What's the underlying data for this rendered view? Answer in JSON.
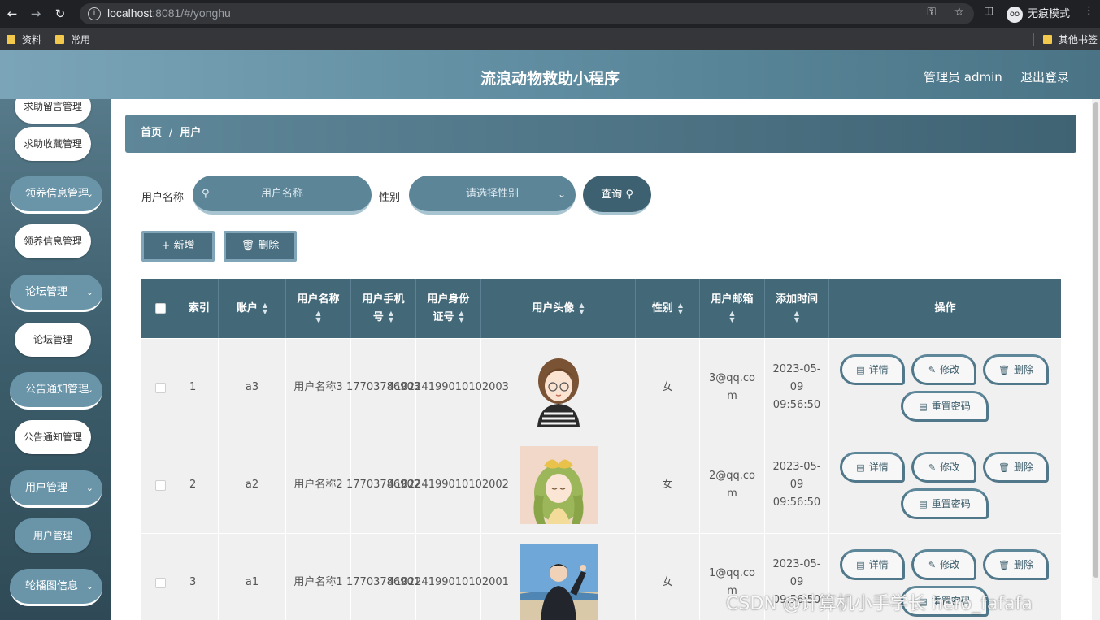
{
  "browser": {
    "url_host": "localhost",
    "url_rest": ":8081/#/yonghu",
    "incognito_label": "无痕模式",
    "bookmarks": [
      "资料",
      "常用"
    ],
    "other_bookmarks": "其他书签"
  },
  "header": {
    "title": "流浪动物救助小程序",
    "user": "管理员 admin",
    "logout": "退出登录"
  },
  "sidebar": {
    "items": [
      {
        "label": "求助留言管理",
        "kind": "sub"
      },
      {
        "label": "求助收藏管理",
        "kind": "sub"
      },
      {
        "label": "领养信息管理",
        "kind": "group"
      },
      {
        "label": "领养信息管理",
        "kind": "sub"
      },
      {
        "label": "论坛管理",
        "kind": "group"
      },
      {
        "label": "论坛管理",
        "kind": "sub"
      },
      {
        "label": "公告通知管理",
        "kind": "group"
      },
      {
        "label": "公告通知管理",
        "kind": "sub"
      },
      {
        "label": "用户管理",
        "kind": "group"
      },
      {
        "label": "用户管理",
        "kind": "sub",
        "active": true
      },
      {
        "label": "轮播图信息",
        "kind": "group"
      }
    ]
  },
  "breadcrumb": {
    "home": "首页",
    "sep": "/",
    "current": "用户"
  },
  "search": {
    "name_label": "用户名称",
    "name_placeholder": "用户名称",
    "gender_label": "性别",
    "gender_placeholder": "请选择性别",
    "query_label": "查询"
  },
  "actions": {
    "add": "新增",
    "delete": "删除"
  },
  "table": {
    "headers": [
      "索引",
      "账户",
      "用户名称",
      "用户手机号",
      "用户身份证号",
      "用户头像",
      "性别",
      "用户邮箱",
      "添加时间",
      "操作"
    ],
    "rows": [
      {
        "index": "1",
        "account": "a3",
        "name": "用户名称3",
        "phone": "17703786903",
        "idcard": "410224199010102003",
        "gender": "女",
        "email": "3@qq.com",
        "time": "2023-05-09 09:56:50"
      },
      {
        "index": "2",
        "account": "a2",
        "name": "用户名称2",
        "phone": "17703786902",
        "idcard": "410224199010102002",
        "gender": "女",
        "email": "2@qq.com",
        "time": "2023-05-09 09:56:50"
      },
      {
        "index": "3",
        "account": "a1",
        "name": "用户名称1",
        "phone": "17703786901",
        "idcard": "410224199010102001",
        "gender": "女",
        "email": "1@qq.com",
        "time": "2023-05-09 09:56:50"
      }
    ],
    "ops": {
      "detail": "详情",
      "edit": "修改",
      "delete": "删除",
      "reset": "重置密码"
    }
  },
  "watermark": "CSDN @计算机小手学长 hero_fafafa",
  "colors": {
    "primary": "#436979",
    "accent": "#6a95a9",
    "header_gradient_start": "#7ba4b8"
  }
}
